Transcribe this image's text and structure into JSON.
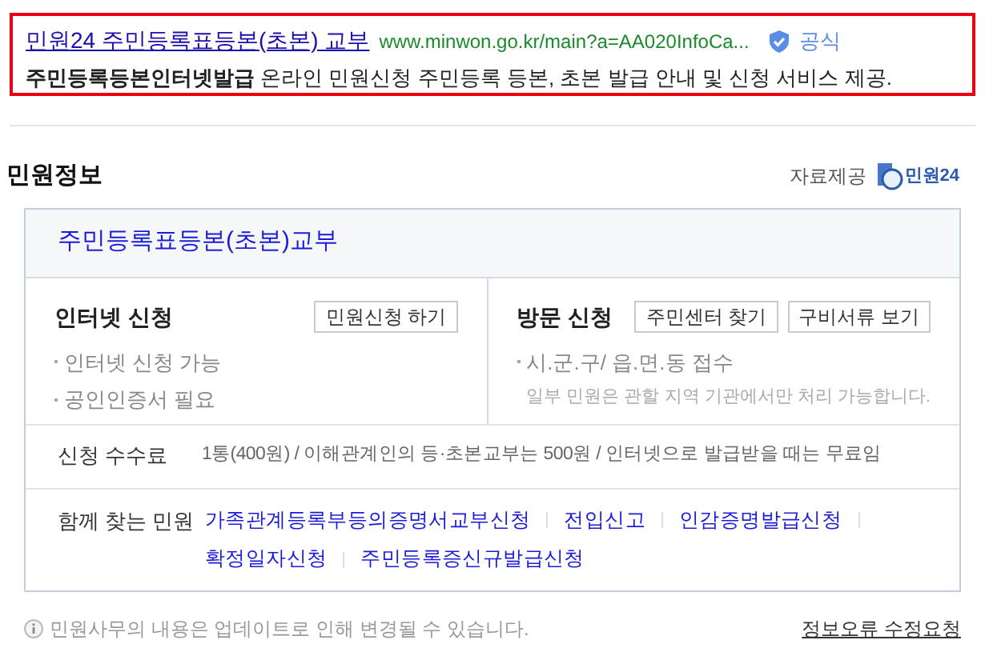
{
  "search_result": {
    "title": "민원24 주민등록표등본(초본) 교부",
    "url": "www.minwon.go.kr/main?a=AA020InfoCa...",
    "badge": "공식",
    "keyword": "주민등록등본인터넷발급",
    "description": "온라인 민원신청 주민등록 등본, 초본 발급 안내 및 신청 서비스 제공."
  },
  "section": {
    "title": "민원정보",
    "provider_label": "자료제공",
    "provider_logo": "민원24"
  },
  "card": {
    "title": "주민등록표등본(초본)교부",
    "methods": [
      {
        "title": "인터넷 신청",
        "buttons": [
          "민원신청 하기"
        ],
        "items": [
          "인터넷 신청 가능",
          "공인인증서 필요"
        ]
      },
      {
        "title": "방문 신청",
        "buttons": [
          "주민센터 찾기",
          "구비서류 보기"
        ],
        "items": [
          "시.군.구/ 읍.면.동 접수"
        ],
        "note": "일부 민원은 관할 지역 기관에서만 처리 가능합니다."
      }
    ],
    "fee": {
      "label": "신청 수수료",
      "value": "1통(400원) / 이해관계인의 등·초본교부는 500원 / 인터넷으로 발급받을 때는 무료임"
    },
    "related": {
      "label": "함께 찾는 민원",
      "links": [
        "가족관계등록부등의증명서교부신청",
        "전입신고",
        "인감증명발급신청",
        "확정일자신청",
        "주민등록증신규발급신청"
      ]
    }
  },
  "footer": {
    "notice": "민원사무의 내용은 업데이트로 인해 변경될 수 있습니다.",
    "link": "정보오류 수정요청"
  }
}
